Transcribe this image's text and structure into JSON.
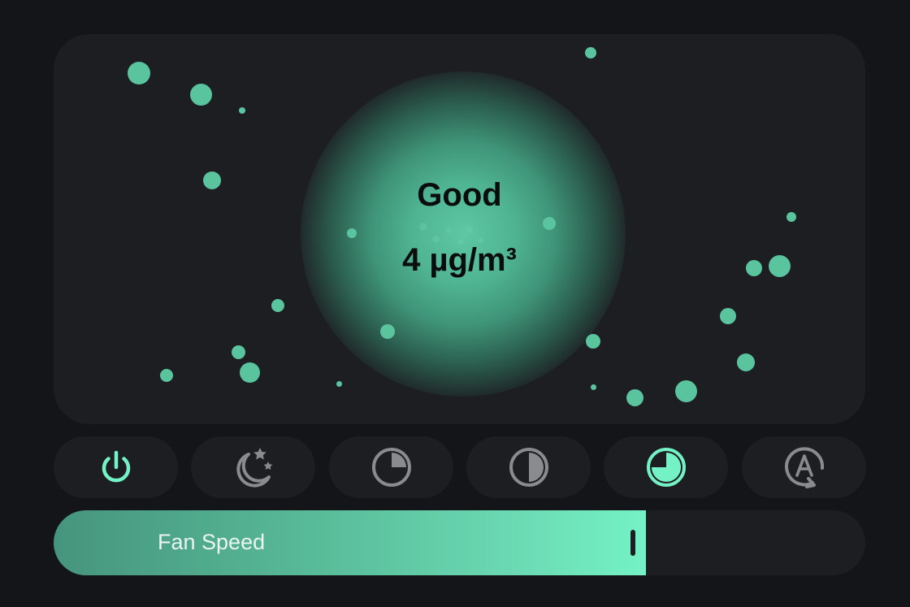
{
  "air_quality": {
    "status": "Good",
    "value_text": "4 µg/m³"
  },
  "modes": [
    {
      "name": "power",
      "icon": "power-icon",
      "active": true
    },
    {
      "name": "sleep",
      "icon": "moon-stars-icon",
      "active": false
    },
    {
      "name": "low",
      "icon": "pie-quarter-icon",
      "active": false
    },
    {
      "name": "medium",
      "icon": "pie-half-icon",
      "active": false
    },
    {
      "name": "high",
      "icon": "pie-three-quarter-icon",
      "active": true
    },
    {
      "name": "auto",
      "icon": "auto-mode-icon",
      "active": false
    }
  ],
  "fan": {
    "label": "Fan Speed",
    "level_percent": 73
  },
  "colors": {
    "accent": "#74f2c5",
    "inactive_icon": "#8a8b8f",
    "panel": "#1d1e22",
    "background": "#141518"
  }
}
